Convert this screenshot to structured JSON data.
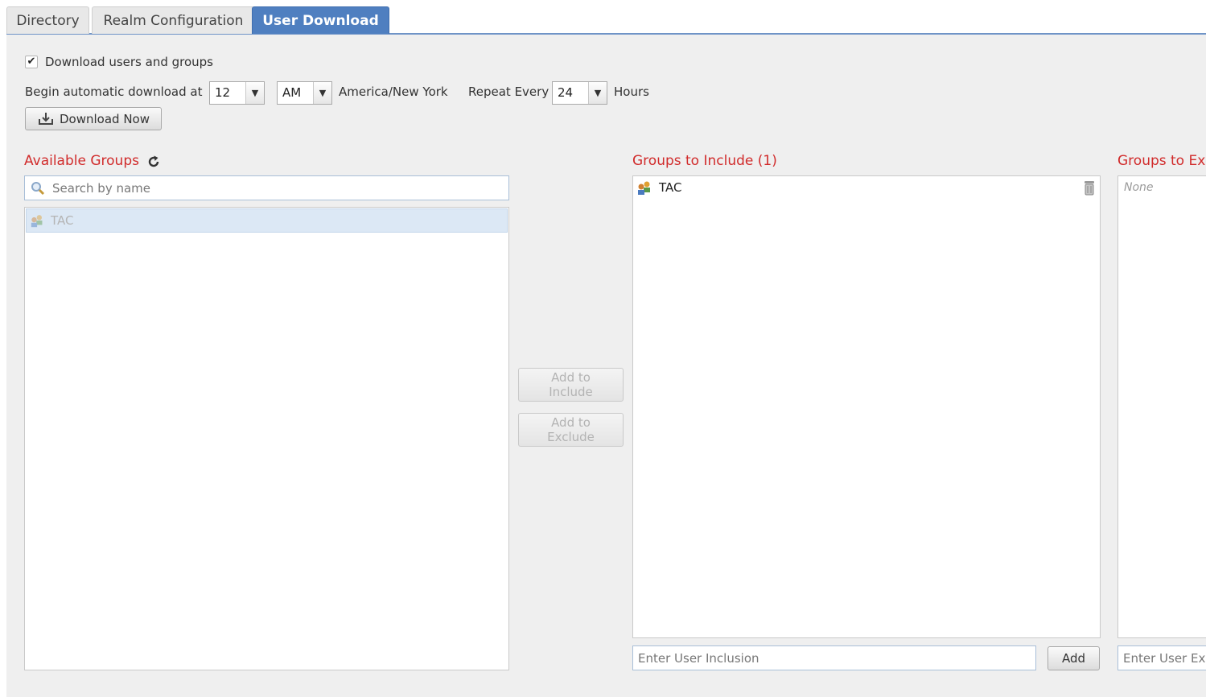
{
  "tabs": [
    {
      "label": "Directory"
    },
    {
      "label": "Realm Configuration"
    },
    {
      "label": "User Download"
    }
  ],
  "active_tab": "User Download",
  "download": {
    "checkbox_label": "Download users and groups",
    "checked": true,
    "begin_label": "Begin automatic download at",
    "hour": "12",
    "ampm": "AM",
    "timezone": "America/New York",
    "repeat_label": "Repeat Every",
    "repeat_value": "24",
    "hours_label": "Hours",
    "download_now_label": "Download Now"
  },
  "available_groups": {
    "title": "Available Groups",
    "search_placeholder": "Search by name",
    "items": [
      "TAC"
    ]
  },
  "middle_buttons": {
    "add_include": "Add to Include",
    "add_exclude": "Add to Exclude"
  },
  "include": {
    "title": "Groups to Include (1)",
    "items": [
      "TAC"
    ],
    "input_placeholder": "Enter User Inclusion",
    "add_label": "Add"
  },
  "exclude": {
    "title": "Groups to Exc",
    "empty_text": "None",
    "input_placeholder": "Enter User Ex"
  },
  "colors": {
    "active_tab": "#4f7fc0",
    "section_title": "#d12b2b",
    "selected_row": "#dce8f5"
  }
}
